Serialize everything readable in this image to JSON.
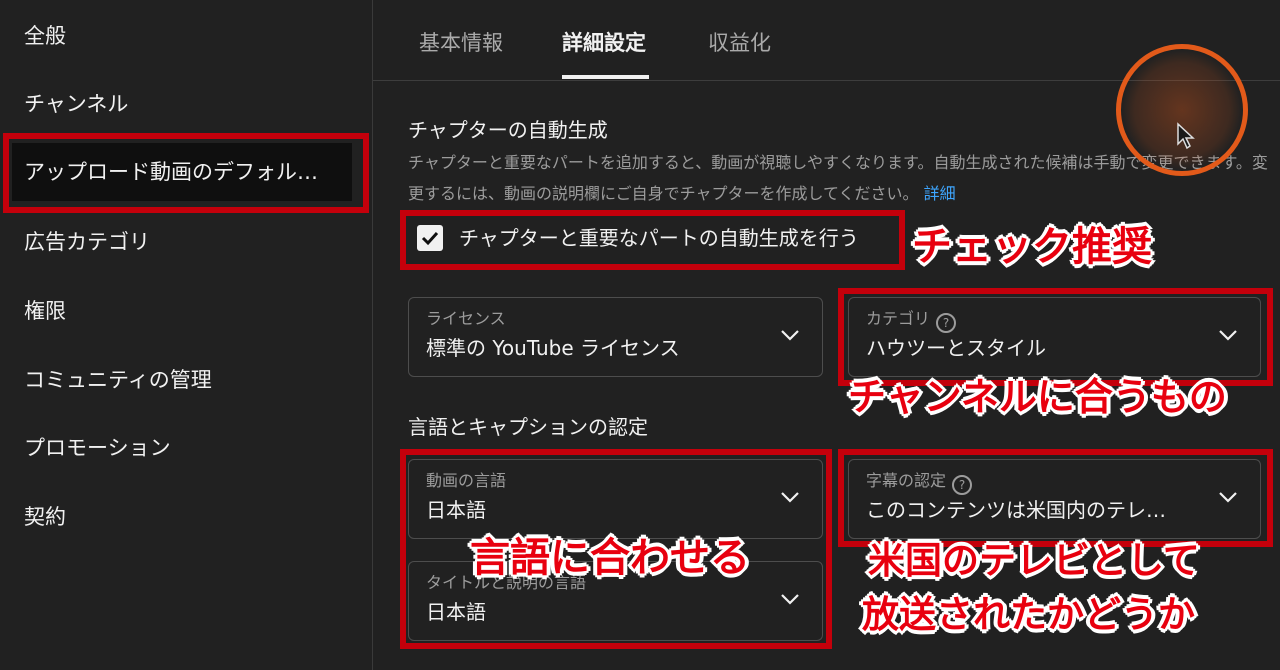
{
  "sidebar": {
    "items": [
      {
        "label": "全般"
      },
      {
        "label": "チャンネル"
      },
      {
        "label": "アップロード動画のデフォル…"
      },
      {
        "label": "広告カテゴリ"
      },
      {
        "label": "権限"
      },
      {
        "label": "コミュニティの管理"
      },
      {
        "label": "プロモーション"
      },
      {
        "label": "契約"
      }
    ]
  },
  "tabs": [
    {
      "label": "基本情報"
    },
    {
      "label": "詳細設定"
    },
    {
      "label": "収益化"
    }
  ],
  "chapters": {
    "title": "チャプターの自動生成",
    "description": "チャプターと重要なパートを追加すると、動画が視聴しやすくなります。自動生成された候補は手動で変更できます。変更するには、動画の説明欄にご自身でチャプターを作成してください。",
    "link": "詳細",
    "checkbox_label": "チャプターと重要なパートの自動生成を行う"
  },
  "license": {
    "label": "ライセンス",
    "value": "標準の YouTube ライセンス"
  },
  "category": {
    "label": "カテゴリ",
    "value": "ハウツーとスタイル"
  },
  "language_section": {
    "title": "言語とキャプションの認定"
  },
  "video_language": {
    "label": "動画の言語",
    "value": "日本語"
  },
  "caption_cert": {
    "label": "字幕の認定",
    "value": "このコンテンツは米国内のテレ…"
  },
  "title_language": {
    "label": "タイトルと説明の言語",
    "value": "日本語"
  },
  "annotations": {
    "check": "チェック推奨",
    "channel": "チャンネルに合うもの",
    "language": "言語に合わせる",
    "tv_line1": "米国のテレビとして",
    "tv_line2": "放送されたかどうか"
  },
  "colors": {
    "highlight": "#c4000b",
    "annotation_text": "#e8000f",
    "link": "#3ea6ff",
    "cursor_ring": "#e25a1a"
  }
}
